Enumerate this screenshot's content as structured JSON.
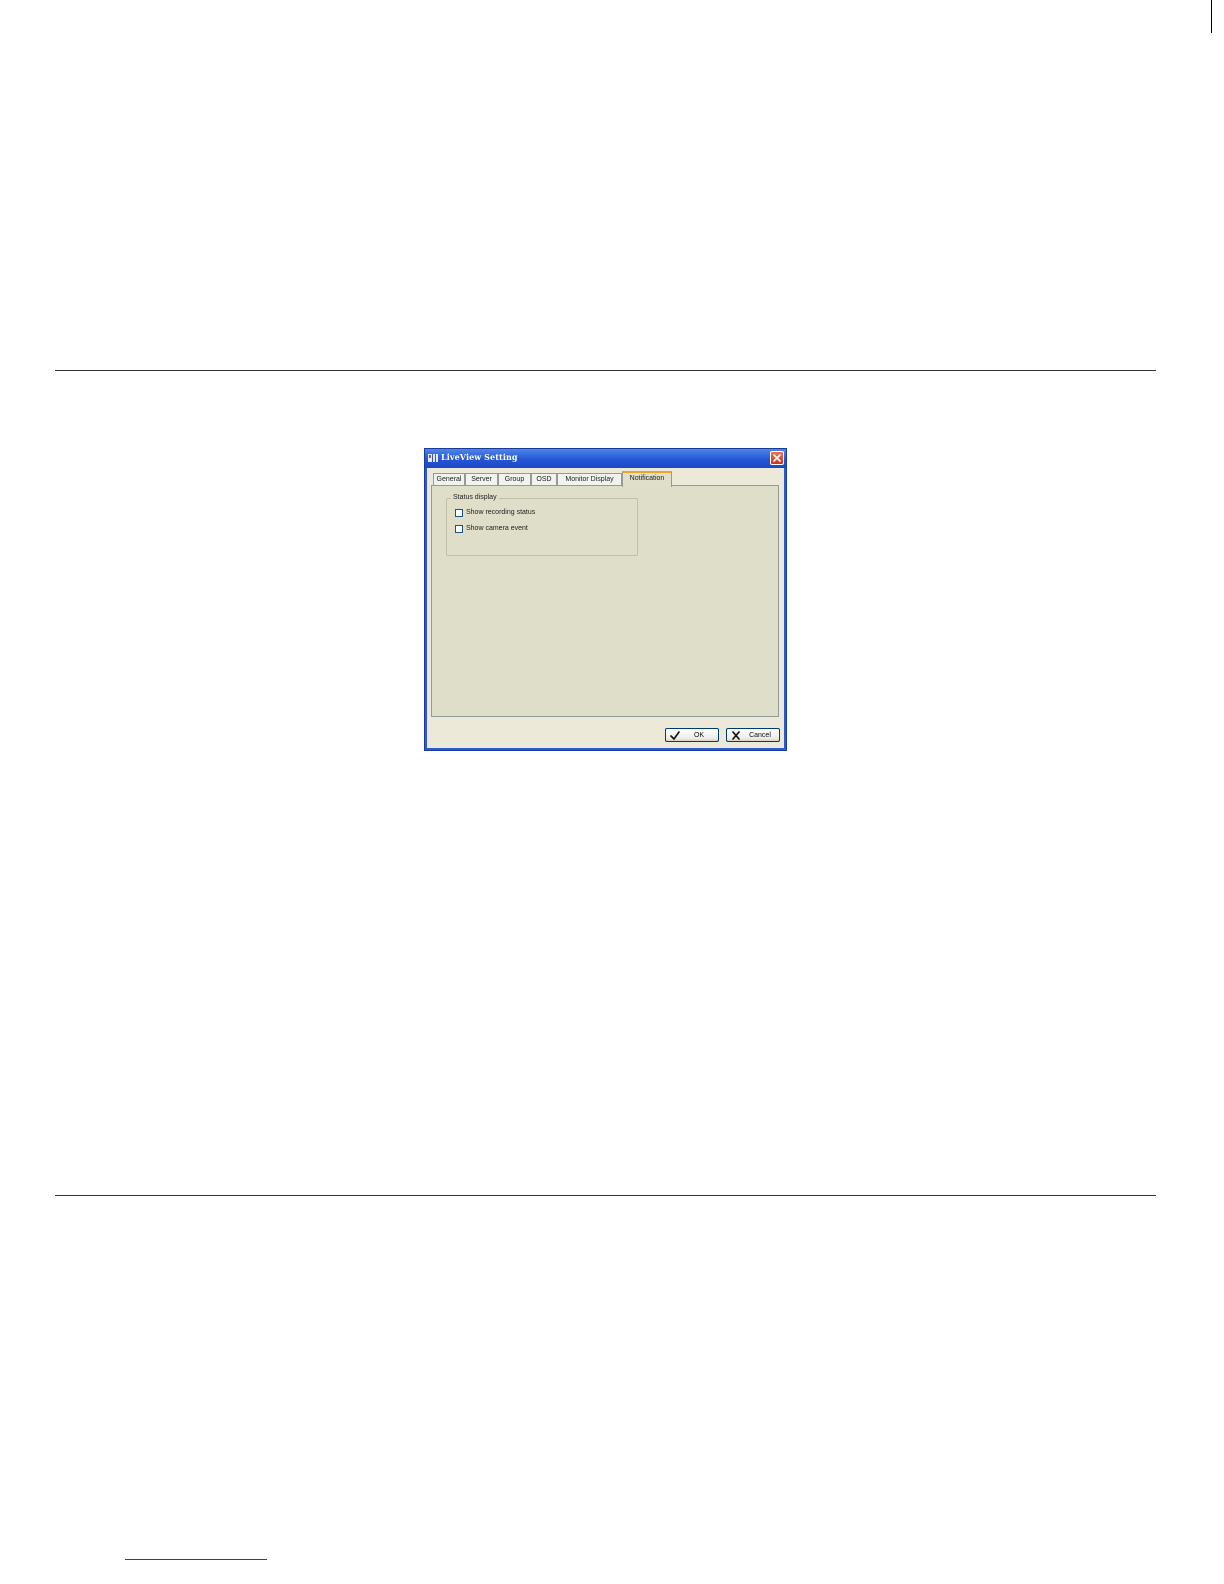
{
  "window": {
    "title": "LiveView Setting"
  },
  "tabs": [
    {
      "label": "General"
    },
    {
      "label": "Server"
    },
    {
      "label": "Group"
    },
    {
      "label": "OSD"
    },
    {
      "label": "Monitor Display"
    },
    {
      "label": "Notification",
      "active": true
    }
  ],
  "status_group": {
    "legend": "Status display",
    "options": [
      {
        "label": "Show recording status",
        "checked": false
      },
      {
        "label": "Show camera event",
        "checked": false
      }
    ]
  },
  "buttons": {
    "ok": "OK",
    "cancel": "Cancel"
  },
  "colors": {
    "titlebar": "#2456d6",
    "dialog_bg": "#ece9d8",
    "panel_bg": "#dfdfc9",
    "close": "#c6381c",
    "active_tab_accent": "#e6a631"
  },
  "icons": {
    "app": "liveview-app-icon",
    "close": "close-icon",
    "ok": "check-icon",
    "cancel": "x-icon"
  }
}
